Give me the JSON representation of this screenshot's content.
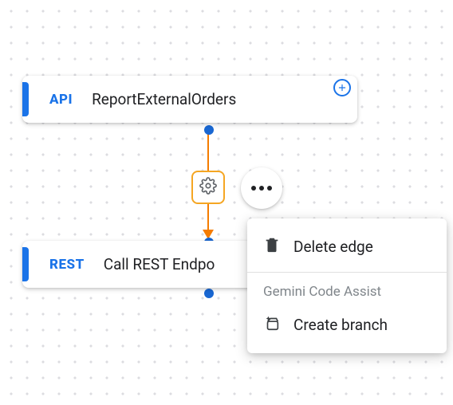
{
  "nodes": {
    "trigger": {
      "type_label": "API",
      "title": "ReportExternalOrders"
    },
    "task": {
      "type_label": "REST",
      "title": "Call REST Endpo"
    }
  },
  "context_menu": {
    "delete_label": "Delete edge",
    "section_label": "Gemini Code Assist",
    "create_branch_label": "Create branch"
  }
}
